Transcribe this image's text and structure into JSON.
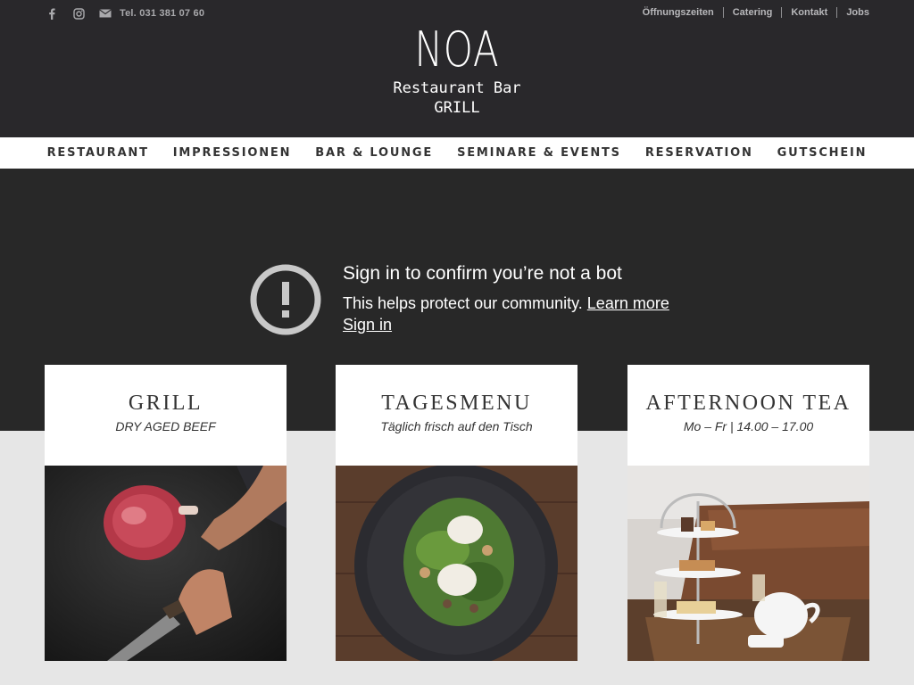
{
  "topbar": {
    "phone": "Tel. 031 381 07 60",
    "links": [
      "Öffnungszeiten",
      "Catering",
      "Kontakt",
      "Jobs"
    ]
  },
  "logo": {
    "name": "NOA",
    "line2": "Restaurant Bar",
    "line3": "GRILL"
  },
  "nav": [
    "RESTAURANT",
    "IMPRESSIONEN",
    "BAR & LOUNGE",
    "SEMINARE & EVENTS",
    "RESERVATION",
    "GUTSCHEIN"
  ],
  "video_notice": {
    "title": "Sign in to confirm you’re not a bot",
    "text": "This helps protect our community.",
    "learn_more": "Learn more",
    "sign_in": "Sign in"
  },
  "cards": [
    {
      "title": "GRILL",
      "subtitle": "DRY AGED BEEF",
      "image": "steak-and-knife"
    },
    {
      "title": "TAGESMENU",
      "subtitle": "Täglich frisch auf den Tisch",
      "image": "salad-plate"
    },
    {
      "title": "AFTERNOON TEA",
      "subtitle": "Mo – Fr | 14.00 – 17.00",
      "image": "tea-tiers"
    }
  ],
  "colors": {
    "header_bg": "#29282b",
    "video_bg": "#282828",
    "page_bg": "#e6e6e6",
    "card_bg": "#ffffff",
    "text": "#333333"
  }
}
